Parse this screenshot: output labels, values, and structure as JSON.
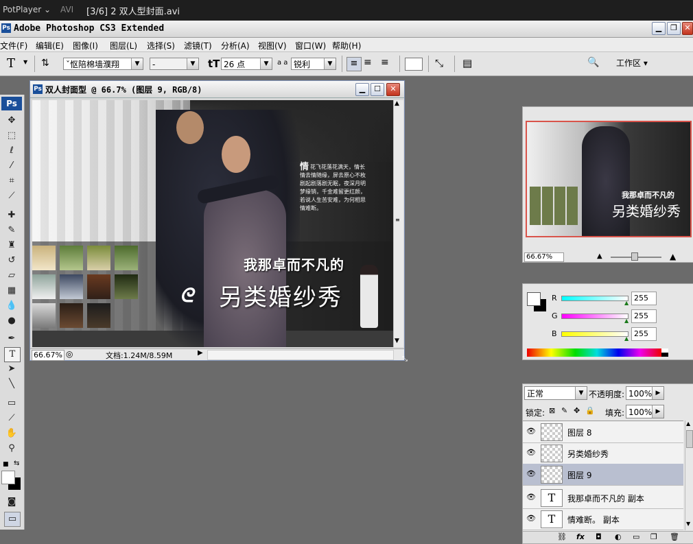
{
  "potplayer": {
    "app": "PotPlayer ⌄",
    "format": "AVI",
    "file": "[3/6] 2 双人型封面.avi"
  },
  "window": {
    "title": "Adobe Photoshop CS3 Extended"
  },
  "menu": [
    "文件(F)",
    "编辑(E)",
    "图像(I)",
    "图层(L)",
    "选择(S)",
    "滤镜(T)",
    "分析(A)",
    "视图(V)",
    "窗口(W)",
    "帮助(H)"
  ],
  "options": {
    "font_family": "ˇ怄陪棉墙濮翔",
    "font_style": "-",
    "font_size": "26 点",
    "aa_label": "a a",
    "antialias": "锐利",
    "workspace": "工作区 ▾"
  },
  "document": {
    "title": "双人封面型 @ 66.7% (图层 9, RGB/8)",
    "zoom": "66.67%",
    "doc_size": "文档:1.24M/8.59M",
    "poem_first_char": "情",
    "poem_lines": [
      "花飞花落花满天，情长",
      "情去情随缘，屏去原心不枚",
      "剧起剧落剧无眠，夜深月明",
      "梦缘销，千金难留更红颜，",
      "若说人生苦安难，为何相思",
      "情难断。"
    ],
    "headline": "我那卓而不凡的",
    "subtitle": "另类婚纱秀"
  },
  "navigator": {
    "zoom": "66.67%"
  },
  "color": {
    "channels": [
      {
        "label": "R",
        "value": "255"
      },
      {
        "label": "G",
        "value": "255"
      },
      {
        "label": "B",
        "value": "255"
      }
    ]
  },
  "layers": {
    "blend_mode": "正常",
    "opacity_label": "不透明度:",
    "opacity": "100%",
    "lock_label": "锁定:",
    "fill_label": "填充:",
    "fill": "100%",
    "items": [
      {
        "name": "图层 8",
        "type": "raster",
        "selected": false
      },
      {
        "name": "另类婚纱秀",
        "type": "raster",
        "selected": false
      },
      {
        "name": "图层 9",
        "type": "raster",
        "selected": true
      },
      {
        "name": "我那卓而不凡的 副本",
        "type": "text",
        "selected": false
      },
      {
        "name": "情难断。 副本",
        "type": "text",
        "selected": false
      }
    ]
  },
  "colors": {
    "accent": "#1a4f9a",
    "canvas_bg": "#6b6b6b",
    "selected_layer": "#b9bfd0"
  }
}
